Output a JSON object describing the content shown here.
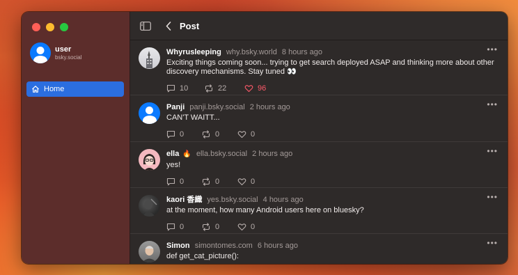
{
  "sidebar": {
    "profile": {
      "name": "user",
      "handle": "bsky.social"
    },
    "items": [
      {
        "label": "Home",
        "icon": "house-icon",
        "active": true
      }
    ]
  },
  "toolbar": {
    "title": "Post"
  },
  "colors": {
    "accent": "#2b6ee0",
    "like": "#ff5a6a",
    "sidebar": "#5c2d2b",
    "main": "#2e2a29"
  },
  "posts": [
    {
      "author": "Whyrusleeping",
      "handle": "why.bsky.world",
      "time": "8 hours ago",
      "text": "Exciting things coming soon... trying to get search deployed ASAP and thinking more about other discovery mechanisms. Stay tuned 👀",
      "replies": "10",
      "reposts": "22",
      "likes": "96",
      "liked": true,
      "avatar": "building-photo"
    },
    {
      "author": "Panji",
      "handle": "panji.bsky.social",
      "time": "2 hours ago",
      "text": "CAN'T WAITT...",
      "replies": "0",
      "reposts": "0",
      "likes": "0",
      "liked": false,
      "avatar": "default-avatar"
    },
    {
      "author": "ella",
      "author_badge": "🔥",
      "handle": "ella.bsky.social",
      "time": "2 hours ago",
      "text": "yes!",
      "replies": "0",
      "reposts": "0",
      "likes": "0",
      "liked": false,
      "avatar": "illustrated-avatar"
    },
    {
      "author": "kaori 香織",
      "handle": "yes.bsky.social",
      "time": "4 hours ago",
      "text": "at the moment, how many Android users here on bluesky?",
      "replies": "0",
      "reposts": "0",
      "likes": "0",
      "liked": false,
      "avatar": "dark-photo"
    },
    {
      "author": "Simon",
      "handle": "simontomes.com",
      "time": "6 hours ago",
      "text": "def get_cat_picture():",
      "avatar": "person-photo"
    }
  ]
}
